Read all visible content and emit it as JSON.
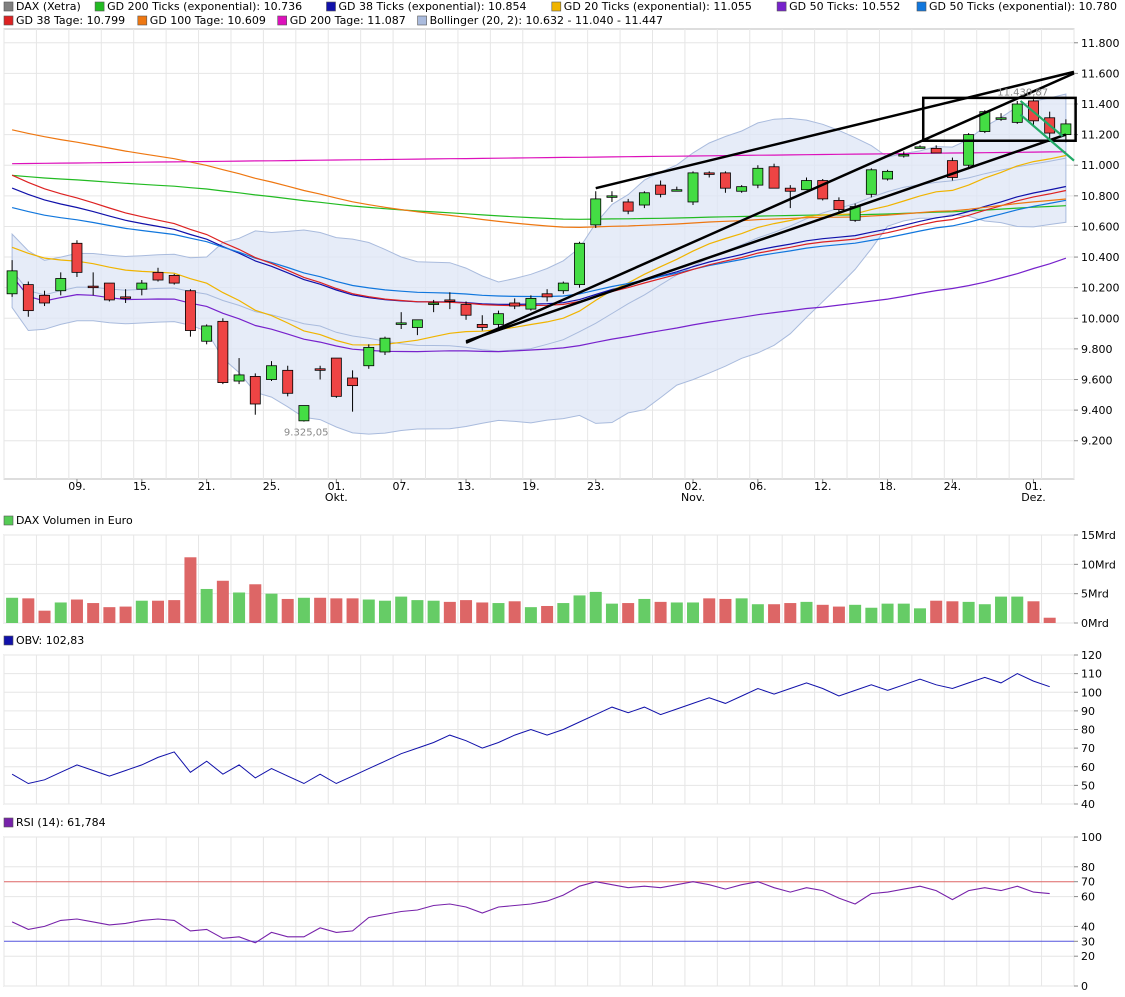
{
  "chart_data": [
    {
      "type": "candlestick",
      "panel": "price",
      "legend": [
        {
          "label": "DAX (Xetra)",
          "color": "#808080"
        },
        {
          "label": "GD 200 Ticks (exponential): 10.736",
          "color": "#22bb22"
        },
        {
          "label": "GD 38 Ticks (exponential): 10.854",
          "color": "#1111aa"
        },
        {
          "label": "GD 20 Ticks (exponential): 11.055",
          "color": "#f0b400"
        },
        {
          "label": "GD 50 Ticks: 10.552",
          "color": "#7722cc"
        },
        {
          "label": "GD 50 Ticks (exponential): 10.780",
          "color": "#1177dd"
        },
        {
          "label": "GD 38 Tage: 10.799",
          "color": "#dd2222"
        },
        {
          "label": "GD 100 Tage: 10.609",
          "color": "#ee7711"
        },
        {
          "label": "GD 200 Tage: 11.087",
          "color": "#dd11bb"
        },
        {
          "label": "Bollinger (20, 2): 10.632 - 11.040 - 11.447",
          "color": "#aabbdd"
        }
      ],
      "y_ticks": [
        "11.800",
        "11.600",
        "11.400",
        "11.200",
        "11.000",
        "10.800",
        "10.600",
        "10.400",
        "10.200",
        "10.000",
        "9.800",
        "9.600",
        "9.400",
        "9.200"
      ],
      "ylim": [
        8950,
        11890
      ],
      "x_ticks": [
        {
          "i": 4,
          "label": "09."
        },
        {
          "i": 8,
          "label": "15."
        },
        {
          "i": 12,
          "label": "21."
        },
        {
          "i": 16,
          "label": "25."
        },
        {
          "i": 20,
          "label": "01.",
          "sub": "Okt."
        },
        {
          "i": 24,
          "label": "07."
        },
        {
          "i": 28,
          "label": "13."
        },
        {
          "i": 32,
          "label": "19."
        },
        {
          "i": 36,
          "label": "23."
        },
        {
          "i": 42,
          "label": "02.",
          "sub": "Nov."
        },
        {
          "i": 46,
          "label": "06."
        },
        {
          "i": 50,
          "label": "12."
        },
        {
          "i": 54,
          "label": "18."
        },
        {
          "i": 58,
          "label": "24."
        },
        {
          "i": 63,
          "label": "01.",
          "sub": "Dez."
        }
      ],
      "annotations": [
        {
          "i": 18,
          "value": 9325,
          "label": "9.325,05"
        },
        {
          "i": 62,
          "value": 11431,
          "label": "11.430,87"
        }
      ],
      "candles": [
        {
          "o": 10160,
          "h": 10380,
          "l": 10140,
          "c": 10310
        },
        {
          "o": 10220,
          "h": 10240,
          "l": 10010,
          "c": 10050
        },
        {
          "o": 10150,
          "h": 10180,
          "l": 10080,
          "c": 10100
        },
        {
          "o": 10180,
          "h": 10300,
          "l": 10150,
          "c": 10260
        },
        {
          "o": 10490,
          "h": 10510,
          "l": 10270,
          "c": 10300
        },
        {
          "o": 10210,
          "h": 10300,
          "l": 10150,
          "c": 10200
        },
        {
          "o": 10230,
          "h": 10230,
          "l": 10110,
          "c": 10120
        },
        {
          "o": 10140,
          "h": 10190,
          "l": 10100,
          "c": 10130
        },
        {
          "o": 10190,
          "h": 10250,
          "l": 10150,
          "c": 10230
        },
        {
          "o": 10300,
          "h": 10330,
          "l": 10240,
          "c": 10250
        },
        {
          "o": 10280,
          "h": 10290,
          "l": 10220,
          "c": 10230
        },
        {
          "o": 10180,
          "h": 10190,
          "l": 9880,
          "c": 9920
        },
        {
          "o": 9850,
          "h": 9960,
          "l": 9830,
          "c": 9950
        },
        {
          "o": 9980,
          "h": 10000,
          "l": 9570,
          "c": 9580
        },
        {
          "o": 9590,
          "h": 9740,
          "l": 9570,
          "c": 9630
        },
        {
          "o": 9620,
          "h": 9640,
          "l": 9370,
          "c": 9440
        },
        {
          "o": 9600,
          "h": 9720,
          "l": 9590,
          "c": 9690
        },
        {
          "o": 9660,
          "h": 9690,
          "l": 9490,
          "c": 9510
        },
        {
          "o": 9330,
          "h": 9420,
          "l": 9325,
          "c": 9430
        },
        {
          "o": 9670,
          "h": 9690,
          "l": 9600,
          "c": 9660
        },
        {
          "o": 9740,
          "h": 9740,
          "l": 9480,
          "c": 9490
        },
        {
          "o": 9610,
          "h": 9660,
          "l": 9390,
          "c": 9560
        },
        {
          "o": 9690,
          "h": 9830,
          "l": 9670,
          "c": 9810
        },
        {
          "o": 9780,
          "h": 9880,
          "l": 9760,
          "c": 9870
        },
        {
          "o": 9960,
          "h": 10040,
          "l": 9930,
          "c": 9970
        },
        {
          "o": 9940,
          "h": 9980,
          "l": 9890,
          "c": 9990
        },
        {
          "o": 10090,
          "h": 10120,
          "l": 10040,
          "c": 10100
        },
        {
          "o": 10120,
          "h": 10170,
          "l": 10060,
          "c": 10110
        },
        {
          "o": 10090,
          "h": 10110,
          "l": 9990,
          "c": 10020
        },
        {
          "o": 9960,
          "h": 10020,
          "l": 9920,
          "c": 9940
        },
        {
          "o": 9960,
          "h": 10050,
          "l": 9940,
          "c": 10030
        },
        {
          "o": 10100,
          "h": 10130,
          "l": 10060,
          "c": 10080
        },
        {
          "o": 10060,
          "h": 10150,
          "l": 10050,
          "c": 10130
        },
        {
          "o": 10160,
          "h": 10190,
          "l": 10110,
          "c": 10140
        },
        {
          "o": 10180,
          "h": 10240,
          "l": 10160,
          "c": 10230
        },
        {
          "o": 10220,
          "h": 10500,
          "l": 10200,
          "c": 10490
        },
        {
          "o": 10610,
          "h": 10830,
          "l": 10590,
          "c": 10780
        },
        {
          "o": 10800,
          "h": 10830,
          "l": 10760,
          "c": 10800
        },
        {
          "o": 10760,
          "h": 10780,
          "l": 10680,
          "c": 10700
        },
        {
          "o": 10740,
          "h": 10830,
          "l": 10720,
          "c": 10820
        },
        {
          "o": 10870,
          "h": 10900,
          "l": 10790,
          "c": 10810
        },
        {
          "o": 10840,
          "h": 10860,
          "l": 10830,
          "c": 10840
        },
        {
          "o": 10760,
          "h": 10960,
          "l": 10740,
          "c": 10950
        },
        {
          "o": 10950,
          "h": 10960,
          "l": 10920,
          "c": 10940
        },
        {
          "o": 10950,
          "h": 10960,
          "l": 10820,
          "c": 10850
        },
        {
          "o": 10830,
          "h": 10870,
          "l": 10820,
          "c": 10860
        },
        {
          "o": 10870,
          "h": 11000,
          "l": 10850,
          "c": 10980
        },
        {
          "o": 10990,
          "h": 11010,
          "l": 10850,
          "c": 10850
        },
        {
          "o": 10850,
          "h": 10870,
          "l": 10720,
          "c": 10830
        },
        {
          "o": 10840,
          "h": 10920,
          "l": 10840,
          "c": 10900
        },
        {
          "o": 10900,
          "h": 10910,
          "l": 10770,
          "c": 10780
        },
        {
          "o": 10770,
          "h": 10790,
          "l": 10690,
          "c": 10710
        },
        {
          "o": 10640,
          "h": 10750,
          "l": 10630,
          "c": 10730
        },
        {
          "o": 10810,
          "h": 10980,
          "l": 10790,
          "c": 10970
        },
        {
          "o": 10910,
          "h": 10970,
          "l": 10900,
          "c": 10960
        },
        {
          "o": 11060,
          "h": 11090,
          "l": 11050,
          "c": 11070
        },
        {
          "o": 11120,
          "h": 11130,
          "l": 11110,
          "c": 11120
        },
        {
          "o": 11110,
          "h": 11130,
          "l": 11080,
          "c": 11080
        },
        {
          "o": 11030,
          "h": 11050,
          "l": 10900,
          "c": 10920
        },
        {
          "o": 11000,
          "h": 11210,
          "l": 10980,
          "c": 11200
        },
        {
          "o": 11220,
          "h": 11360,
          "l": 11210,
          "c": 11350
        },
        {
          "o": 11300,
          "h": 11340,
          "l": 11290,
          "c": 11310
        },
        {
          "o": 11280,
          "h": 11420,
          "l": 11270,
          "c": 11400
        },
        {
          "o": 11420,
          "h": 11431,
          "l": 11260,
          "c": 11290
        },
        {
          "o": 11310,
          "h": 11350,
          "l": 11170,
          "c": 11210
        },
        {
          "o": 11200,
          "h": 11300,
          "l": 11150,
          "c": 11270
        }
      ]
    },
    {
      "type": "bar",
      "panel": "volume",
      "legend": [
        {
          "label": "DAX Volumen in Euro",
          "color": "#55cc55"
        }
      ],
      "y_ticks": [
        "15Mrd",
        "10Mrd",
        "5Mrd",
        "0Mrd"
      ],
      "ylim": [
        0,
        15
      ],
      "colors": {
        "up": "#66cc66",
        "down": "#dd6666"
      },
      "values": [
        4.3,
        4.2,
        2.1,
        3.5,
        4.0,
        3.4,
        2.7,
        2.8,
        3.8,
        3.8,
        3.9,
        11.2,
        5.8,
        7.2,
        5.2,
        6.6,
        5.0,
        4.1,
        4.3,
        4.3,
        4.2,
        4.2,
        4.0,
        3.8,
        4.5,
        3.9,
        3.8,
        3.6,
        3.9,
        3.5,
        3.4,
        3.7,
        2.7,
        2.9,
        3.4,
        4.7,
        5.3,
        3.3,
        3.4,
        4.1,
        3.6,
        3.5,
        3.5,
        4.2,
        4.1,
        4.2,
        3.2,
        3.2,
        3.4,
        3.6,
        3.1,
        2.8,
        3.1,
        2.6,
        3.3,
        3.3,
        2.5,
        3.8,
        3.7,
        3.6,
        3.2,
        4.5,
        4.5,
        3.7,
        0.9
      ]
    },
    {
      "type": "line",
      "panel": "obv",
      "legend": [
        {
          "label": "OBV: 102,83",
          "color": "#1111aa"
        }
      ],
      "y_ticks": [
        "120",
        "110",
        "100",
        "90",
        "80",
        "70",
        "60",
        "50",
        "40"
      ],
      "ylim": [
        40,
        120
      ],
      "values": [
        56,
        51,
        53,
        57,
        61,
        58,
        55,
        58,
        61,
        65,
        68,
        57,
        63,
        56,
        61,
        54,
        59,
        55,
        51,
        56,
        51,
        55,
        59,
        63,
        67,
        70,
        73,
        77,
        74,
        70,
        73,
        77,
        80,
        77,
        80,
        84,
        88,
        92,
        89,
        92,
        88,
        91,
        94,
        97,
        94,
        98,
        102,
        99,
        102,
        105,
        102,
        98,
        101,
        104,
        101,
        104,
        107,
        104,
        102,
        105,
        108,
        105,
        110,
        106,
        103
      ]
    },
    {
      "type": "line",
      "panel": "rsi",
      "legend": [
        {
          "label": "RSI (14): 61,784",
          "color": "#7722aa"
        }
      ],
      "y_ticks": [
        "100",
        "80",
        "70",
        "60",
        "40",
        "30",
        "20",
        "0"
      ],
      "ylim": [
        0,
        100
      ],
      "reference_lines": [
        {
          "value": 70,
          "label": "70",
          "color": "#dd6666"
        },
        {
          "value": 30,
          "label": "30",
          "color": "#5555dd"
        }
      ],
      "values": [
        43,
        38,
        40,
        44,
        45,
        43,
        41,
        42,
        44,
        45,
        44,
        37,
        38,
        32,
        33,
        29,
        36,
        33,
        33,
        39,
        36,
        37,
        46,
        48,
        50,
        51,
        54,
        55,
        53,
        49,
        53,
        54,
        55,
        57,
        61,
        67,
        70,
        68,
        66,
        67,
        66,
        68,
        70,
        68,
        65,
        68,
        70,
        66,
        63,
        66,
        64,
        59,
        55,
        62,
        63,
        65,
        67,
        64,
        58,
        64,
        66,
        64,
        67,
        63,
        62
      ]
    }
  ]
}
